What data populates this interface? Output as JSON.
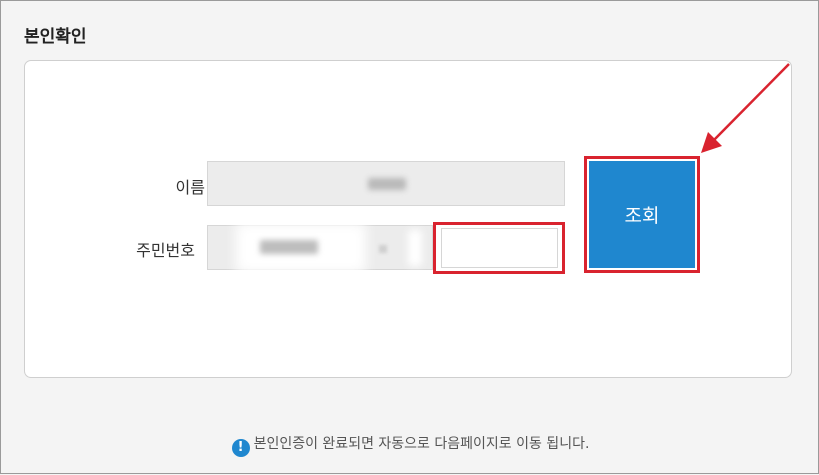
{
  "section_title": "본인확인",
  "form": {
    "name_label": "이름",
    "rrn_label": "주민번호",
    "rrn_back_value": "",
    "search_button": "조회"
  },
  "notice": {
    "icon": "!",
    "text": "본인인증이 완료되면 자동으로 다음페이지로 이동 됩니다."
  },
  "colors": {
    "accent": "#1f87cf",
    "highlight": "#d9232f"
  }
}
